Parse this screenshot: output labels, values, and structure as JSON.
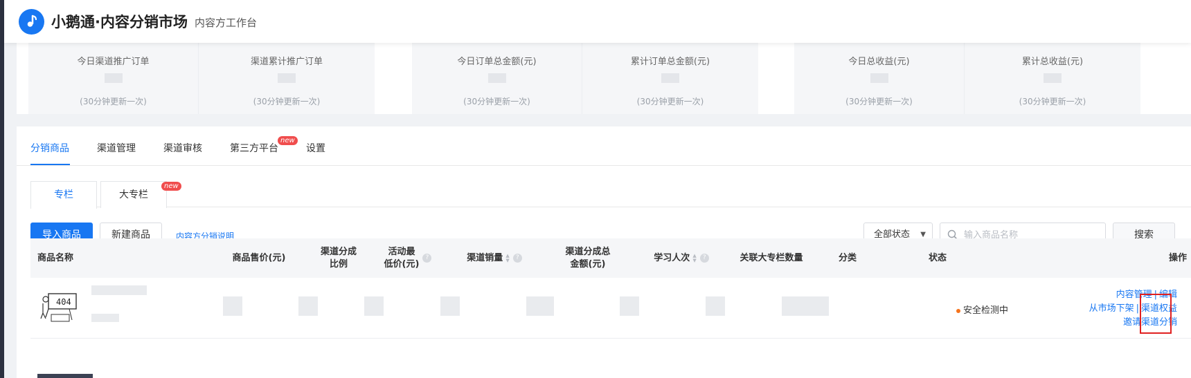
{
  "header": {
    "brand": "小鹅通·内容分销市场",
    "subtitle": "内容方工作台"
  },
  "stats": [
    {
      "label": "今日渠道推广订单",
      "note": "(30分钟更新一次)"
    },
    {
      "label": "渠道累计推广订单",
      "note": "(30分钟更新一次)"
    },
    {
      "label": "今日订单总金额(元)",
      "note": "(30分钟更新一次)"
    },
    {
      "label": "累计订单总金额(元)",
      "note": "(30分钟更新一次)"
    },
    {
      "label": "今日总收益(元)",
      "note": "(30分钟更新一次)"
    },
    {
      "label": "累计总收益(元)",
      "note": "(30分钟更新一次)"
    }
  ],
  "tabs": [
    {
      "label": "分销商品",
      "active": true
    },
    {
      "label": "渠道管理"
    },
    {
      "label": "渠道审核"
    },
    {
      "label": "第三方平台",
      "badge": "new"
    },
    {
      "label": "设置"
    }
  ],
  "subtabs": [
    {
      "label": "专栏",
      "active": true
    },
    {
      "label": "大专栏",
      "badge": "new"
    }
  ],
  "toolbar": {
    "import_label": "导入商品",
    "create_label": "新建商品",
    "explain_link": "内容方分销说明",
    "status_select": "全部状态",
    "search_placeholder": "输入商品名称",
    "search_button": "搜索"
  },
  "table": {
    "columns": {
      "name": "商品名称",
      "price": "商品售价(元)",
      "ratio_1": "渠道分成",
      "ratio_2": "比例",
      "min_price_1": "活动最",
      "min_price_2": "低价(元)",
      "sales": "渠道销量",
      "total_1": "渠道分成总",
      "total_2": "金额(元)",
      "learners": "学习人次",
      "linked": "关联大专栏数量",
      "category": "分类",
      "status": "状态",
      "ops": "操作"
    },
    "rows": [
      {
        "thumb_text": "404",
        "status": "安全检测中",
        "ops": {
          "content": "内容管理",
          "edit": "编辑",
          "delist": "从市场下架",
          "rights": "渠道权益",
          "invite": "邀请渠道分销"
        }
      }
    ]
  },
  "colors": {
    "accent": "#1877f2",
    "badge": "#f04d4d",
    "status_dot": "#f5731c",
    "highlight": "#e02020"
  }
}
